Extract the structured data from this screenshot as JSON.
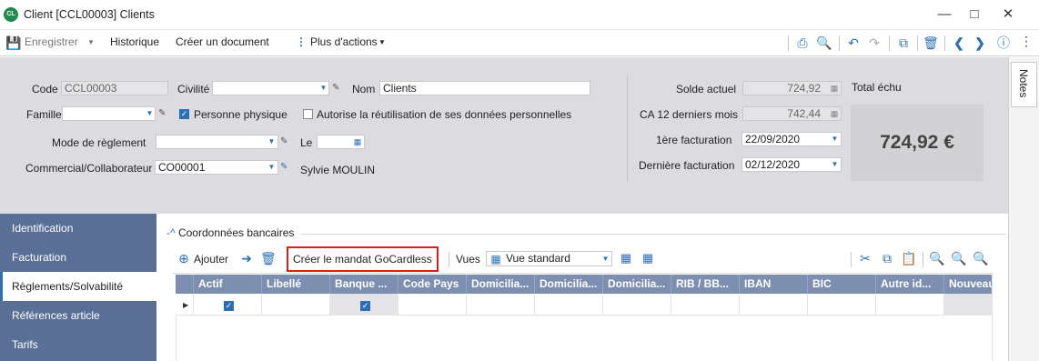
{
  "window": {
    "app_icon_text": "CL",
    "title": "Client [CCL00003] Clients",
    "minimize_icon": "minimize-icon",
    "maximize_icon": "maximize-icon",
    "close_icon": "close-icon"
  },
  "toolbar": {
    "save_label": "Enregistrer",
    "history_label": "Historique",
    "create_doc_label": "Créer un document",
    "more_actions_label": "Plus d'actions"
  },
  "form": {
    "code_label": "Code",
    "code_value": "CCL00003",
    "civilite_label": "Civilité",
    "civilite_value": "",
    "nom_label": "Nom",
    "nom_value": "Clients",
    "famille_label": "Famille",
    "famille_value": "",
    "personne_physique_label": "Personne physique",
    "personne_physique_checked": true,
    "autorise_label": "Autorise la réutilisation de ses données personnelles",
    "autorise_checked": false,
    "mode_reglement_label": "Mode de règlement",
    "mode_reglement_value": "",
    "le_label": "Le",
    "le_value": "",
    "commercial_label": "Commercial/Collaborateur",
    "commercial_value": "CO00001",
    "commercial_name": "Sylvie MOULIN"
  },
  "summary": {
    "solde_label": "Solde actuel",
    "solde_value": "724,92",
    "ca_label": "CA 12 derniers mois",
    "ca_value": "742,44",
    "premiere_label": "1ère facturation",
    "premiere_value": "22/09/2020",
    "derniere_label": "Dernière facturation",
    "derniere_value": "02/12/2020",
    "total_echu_label": "Total échu",
    "total_echu_value": "724,92 €"
  },
  "notes_tab_label": "Notes",
  "nav": {
    "items": [
      {
        "label": "Identification"
      },
      {
        "label": "Facturation"
      },
      {
        "label": "Règlements/Solvabilité"
      },
      {
        "label": "Références article"
      },
      {
        "label": "Tarifs"
      }
    ],
    "active_index": 2
  },
  "section": {
    "title": "Coordonnées bancaires",
    "add_label": "Ajouter",
    "mandat_label": "Créer le mandat GoCardless",
    "vues_label": "Vues",
    "vue_value": "Vue standard"
  },
  "grid": {
    "columns": [
      "Actif",
      "Libellé",
      "Banque ...",
      "Code Pays",
      "Domicilia...",
      "Domicilia...",
      "Domicilia...",
      "RIB / BB...",
      "IBAN",
      "BIC",
      "Autre id...",
      "Nouveau"
    ],
    "rows": [
      {
        "actif": true,
        "libelle": "",
        "banque": true
      }
    ]
  },
  "colors": {
    "accent": "#2c6fb7",
    "nav_bg": "#5a6f96",
    "grid_header": "#7d8fb1",
    "highlight_border": "#d61f1f"
  }
}
